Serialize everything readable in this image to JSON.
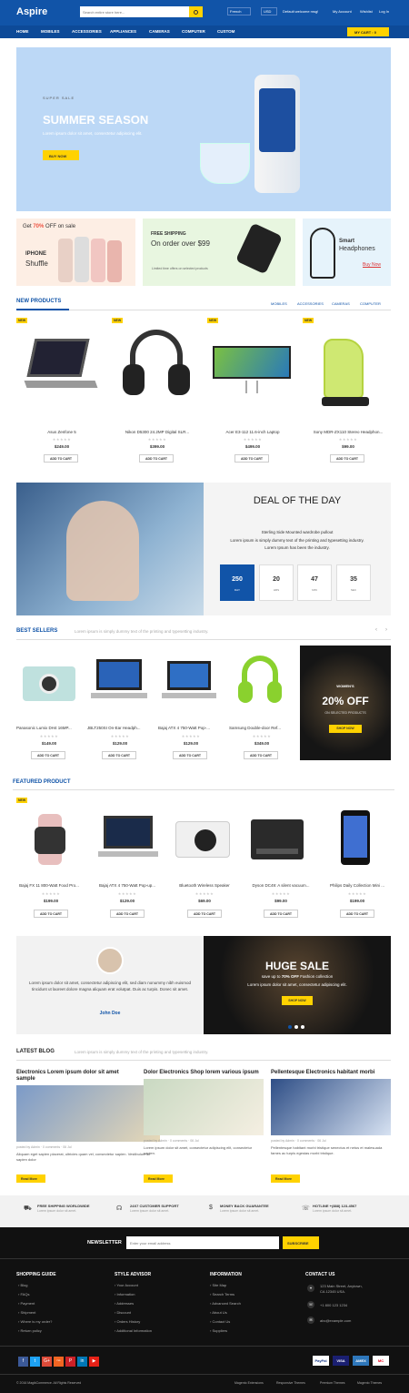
{
  "header": {
    "logo": "Aspire",
    "search_placeholder": "Search entire store here...",
    "language": "French",
    "currency": "USD",
    "welcome": "Default welcome msg!",
    "account": "My Account",
    "wishlist": "Wishlist",
    "login": "Log In"
  },
  "nav": {
    "items": [
      "HOME",
      "MOBILES",
      "ACCESSORIES",
      "APPLIANCES",
      "CAMERAS",
      "COMPUTER",
      "CUSTOM"
    ],
    "cart": "MY CART : 0"
  },
  "hero": {
    "kicker": "SUPER SALE",
    "title": "SUMMER SEASON",
    "text": "Lorem ipsum dolor sit amet, consectetur adipiscing elit.",
    "button": "BUY NOW"
  },
  "banners": {
    "b1_get": "Get",
    "b1_pct": "70%",
    "b1_off": "OFF on sale",
    "b1_title1": "IPHONE",
    "b1_title2": "Shuffle",
    "b2_kicker": "FREE SHIPPING",
    "b2_title": "On order over $99",
    "b2_text": "Limited time offers on selected products",
    "b3_title1": "Smart",
    "b3_title2": "Headphones",
    "b3_link": "Buy Now"
  },
  "new_products": {
    "title": "NEW PRODUCTS",
    "tabs": [
      "MOBILES",
      "ACCESSORIES",
      "CAMERAS",
      "COMPUTER"
    ],
    "badge": "NEW",
    "add": "ADD TO CART",
    "stars": "★★★★★",
    "items": [
      {
        "name": "Asus Zenfone 5",
        "price": "$249.00"
      },
      {
        "name": "Nikon D5300 24.2MP Digital SLR...",
        "price": "$399.00"
      },
      {
        "name": "Acer E3-112 11.6-inch Laptop",
        "price": "$499.00"
      },
      {
        "name": "Sony MDR-ZX110 Stereo Headphon...",
        "price": "$99.00"
      }
    ]
  },
  "deal": {
    "title": "DEAL OF THE DAY",
    "line1": "Sterling Side Mounted wardrobe pullout",
    "line2": "Lorem ipsum is simply dummy text of the printing and typesetting industry.",
    "line3": "Lorem Ipsum has been the industry.",
    "counters": [
      {
        "n": "250",
        "l": "DAY"
      },
      {
        "n": "20",
        "l": "HRS"
      },
      {
        "n": "47",
        "l": "MIN"
      },
      {
        "n": "35",
        "l": "SEC"
      }
    ]
  },
  "best_sellers": {
    "title": "BEST SELLERS",
    "subtitle": "Lorem ipsum is simply dummy text of the printing and typesetting industry.",
    "add": "ADD TO CART",
    "stars": "★★★★★",
    "items": [
      {
        "name": "Panasonic Lumix DH4 16MP...",
        "price": "$149.00"
      },
      {
        "name": "JBLT250SI On-Ear Headph...",
        "price": "$129.00"
      },
      {
        "name": "Bajaj ATX 4 750-Watt Pop-...",
        "price": "$129.00"
      },
      {
        "name": "Samsung Double-door Ref...",
        "price": "$349.00"
      }
    ],
    "promo": {
      "kicker": "WOMEN'S",
      "big": "20% OFF",
      "small": "ON SELECTED PRODUCTS",
      "button": "SHOP NOW"
    }
  },
  "featured": {
    "title": "FEATURED PRODUCT",
    "badge": "NEW",
    "add": "ADD TO CART",
    "stars": "★★★★★",
    "items": [
      {
        "name": "Bajaj FX 11 800-Watt Food Pro...",
        "price": "$199.00"
      },
      {
        "name": "Bajaj ATX 4 750-Watt Pop-up...",
        "price": "$129.00"
      },
      {
        "name": "Bluetooth Wireless Speaker",
        "price": "$69.00"
      },
      {
        "name": "Dyson DC49: A silent vacuum...",
        "price": "$99.00"
      },
      {
        "name": "Philips Daily Collection Mini ...",
        "price": "$199.00"
      }
    ]
  },
  "testimonial": {
    "text": "Lorem ipsum dolor sit amet, consectetur adipiscing elit, sed diam nonummy nibh euismod tincidunt ut laoreet dolore magna aliquam erat volutpat. Duis ac turpis. Donec sit amet.",
    "author": "John Doe"
  },
  "huge_sale": {
    "title": "HUGE SALE",
    "line1a": "save up to",
    "line1b": "70% OFF",
    "line1c": "Fashion collection",
    "line2": "Lorem ipsum dolor sit amet, consectetur adipiscing elit.",
    "button": "SHOP NOW"
  },
  "blog": {
    "title": "LATEST BLOG",
    "subtitle": "Lorem ipsum is simply dummy text of the printing and typesetting industry.",
    "readmore": "Read More",
    "posts": [
      {
        "title": "Electronics Lorem ipsum dolor sit amet sample",
        "by": "posted by Admin",
        "comments": "0 comments",
        "date": "06 Jul",
        "text": "Aliquam eget sapien placerat, ultricies quam vel, consectetur sapien. Vestibulum at sapien dolor"
      },
      {
        "title": "Dolor Electronics Shop lorem various ipsum",
        "by": "posted by Admin",
        "comments": "0 comments",
        "date": "06 Jul",
        "text": "Lorem ipsum dolor sit amet, consectetur adipiscing elit, consectetur sapien."
      },
      {
        "title": "Pellentesque Electronics habitant morbi",
        "by": "posted by Admin",
        "comments": "0 comments",
        "date": "06 Jul",
        "text": "Pellentesque habitant morbi tristique senectus et netus et malesuada fames ac turpis egestas morbi tristique."
      }
    ]
  },
  "features": [
    {
      "t": "FREE SHIPPING WORLDWIDE",
      "s": "Lorem ipsum dolor sit amet."
    },
    {
      "t": "24X7 CUSTOMER SUPPORT",
      "s": "Lorem ipsum dolor sit amet."
    },
    {
      "t": "MONEY BACK GUARANTEE",
      "s": "Lorem ipsum dolor sit amet."
    },
    {
      "t": "HOTLINE +(888) 123-4567",
      "s": "Lorem ipsum dolor sit amet."
    }
  ],
  "newsletter": {
    "label": "NEWSLETTER",
    "placeholder": "Enter your email address",
    "button": "SUBSCRIBE"
  },
  "footer": {
    "shopping_guide": {
      "title": "SHOPPING GUIDE",
      "links": [
        "Blog",
        "FAQs",
        "Payment",
        "Shipment",
        "Where is my order?",
        "Return policy"
      ]
    },
    "style_advisor": {
      "title": "STYLE ADVISOR",
      "links": [
        "Your Account",
        "Information",
        "Addresses",
        "Discount",
        "Orders History",
        "Additional Information"
      ]
    },
    "information": {
      "title": "INFORMATION",
      "links": [
        "Site Map",
        "Search Terms",
        "Advanced Search",
        "About Us",
        "Contact Us",
        "Suppliers"
      ]
    },
    "contact": {
      "title": "CONTACT US",
      "address1": "123 Main Street, Anytown,",
      "address2": "CA 12345 USA.",
      "phone": "+1 800 123 1234",
      "email": "abc@example.com"
    },
    "social": [
      "f",
      "t",
      "G+",
      "rss",
      "P",
      "in",
      "▶"
    ],
    "payments": [
      "PayPal",
      "VISA",
      "AMEX",
      "MC"
    ],
    "copyright": "© 2016 MagikCommerce. All Rights Reserved",
    "bottom_links": [
      "Magento Extensions",
      "Responsive Themes",
      "Premium Themes",
      "Magento Themes"
    ]
  },
  "colors": {
    "primary": "#1154a8",
    "accent": "#ffd200",
    "footer": "#111111"
  }
}
